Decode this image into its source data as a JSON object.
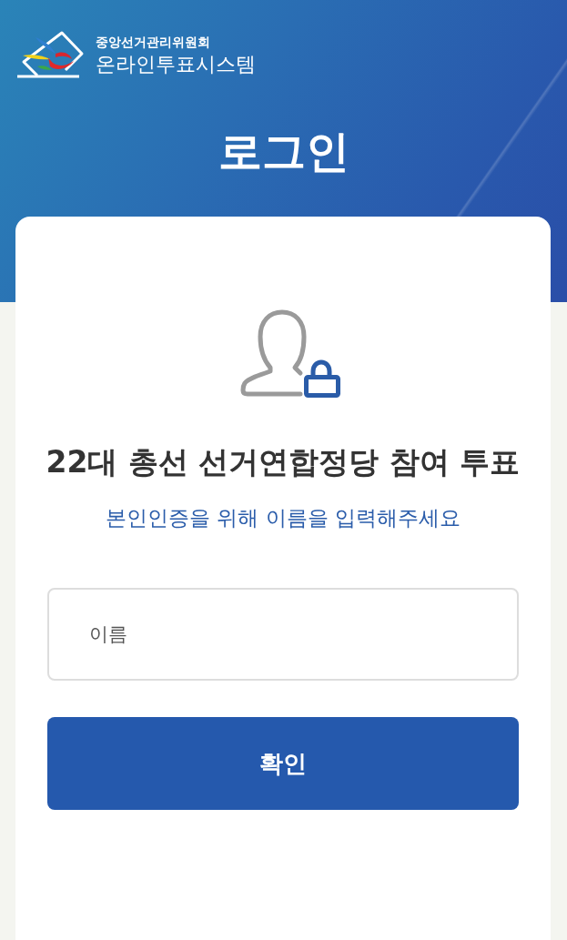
{
  "header": {
    "organization": "중앙선거관리위원회",
    "system_name": "온라인투표시스템",
    "title": "로그인"
  },
  "card": {
    "heading": "22대 총선 선거연합정당 참여 투표",
    "instruction": "본인인증을 위해 이름을 입력해주세요",
    "name_field": {
      "placeholder": "이름"
    },
    "buttons": [
      "확인"
    ]
  }
}
